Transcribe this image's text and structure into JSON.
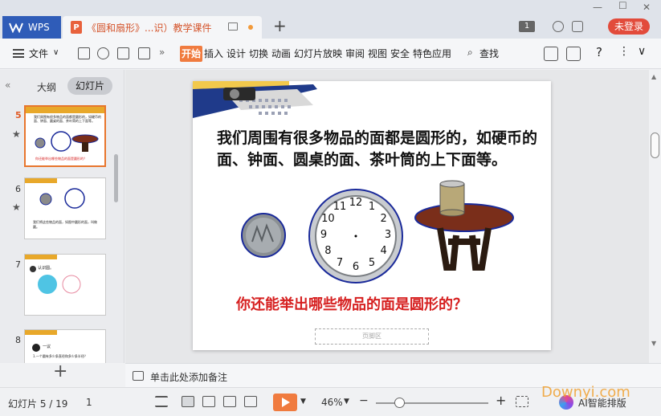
{
  "titlebar": {
    "app_tab": "WPS",
    "doc_tab": "《圆和扇形》...识）教学课件",
    "login_button": "未登录",
    "badge": "1"
  },
  "menu": {
    "file": "文件",
    "tabs": [
      "开始",
      "插入",
      "设计",
      "切换",
      "动画",
      "幻灯片放映",
      "审阅",
      "视图",
      "安全",
      "特色应用"
    ],
    "search": "查找"
  },
  "left_panel": {
    "outline_tab": "大纲",
    "slides_tab": "幻灯片",
    "thumbnails": [
      {
        "num": "5",
        "selected": true,
        "has_star": true
      },
      {
        "num": "6",
        "selected": false,
        "has_star": true
      },
      {
        "num": "7",
        "selected": false,
        "has_star": false
      },
      {
        "num": "8",
        "selected": false,
        "has_star": false
      }
    ],
    "thumb_text": {
      "t5": "我们周围有很多物品的面都是圆形的，如硬币的面、钟面、圆桌的面、茶叶筒的上下面等。",
      "t5_red": "你还能举出哪些物品的面是圆形的？",
      "t6": "我们将这些物品的面，如图中圆形的面，叫做圆。",
      "t7": "认识圆。",
      "t8": "一议",
      "t8_body": "1.一个圆有多少条直径和多少条半径？"
    }
  },
  "slide": {
    "text": "我们周围有很多物品的面都是圆形的，如硬币的面、钟面、圆桌的面、茶叶筒的上下面等。",
    "question": "你还能举出哪些物品的面是圆形的？",
    "notes_placeholder": "页脚区",
    "clock_numbers": [
      "12",
      "1",
      "2",
      "3",
      "4",
      "5",
      "6",
      "7",
      "8",
      "9",
      "10",
      "11"
    ]
  },
  "notes_bar": {
    "label": "单击此处添加备注"
  },
  "status": {
    "slide_counter": "幻灯片 5 / 19",
    "page": "1",
    "zoom": "46%",
    "ai_label": "AI智能排版",
    "watermark": "Downyi.com"
  }
}
